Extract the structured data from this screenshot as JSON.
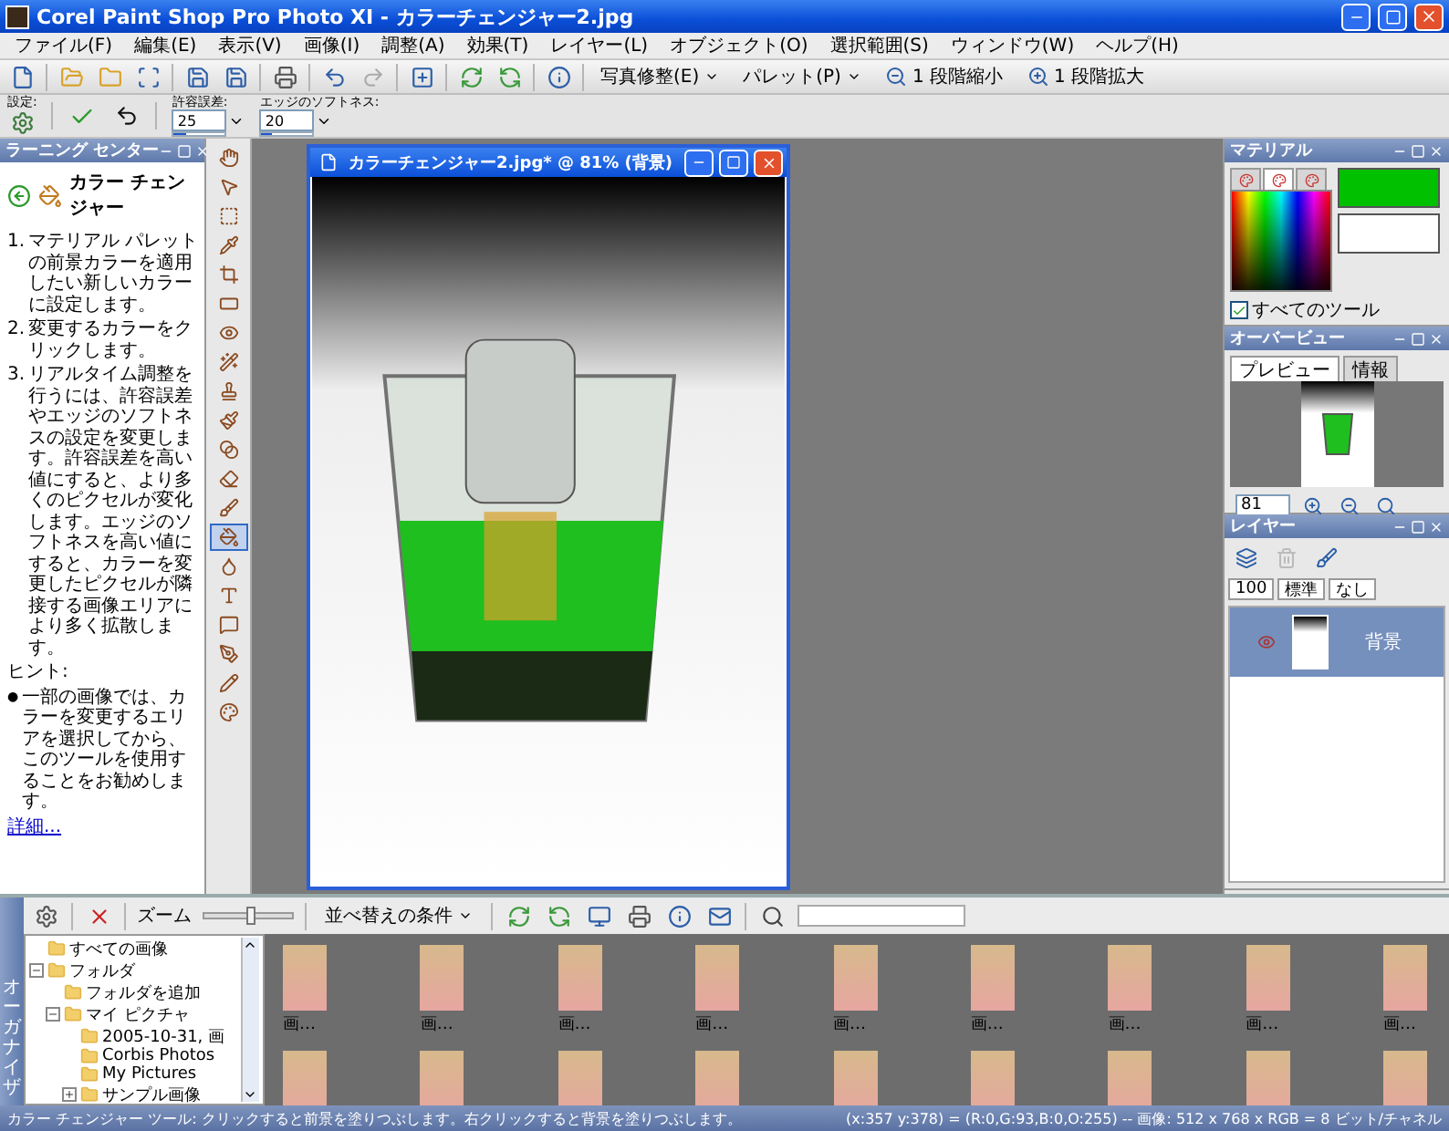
{
  "window": {
    "title": "Corel Paint Shop Pro Photo XI - カラーチェンジャー2.jpg"
  },
  "menu": [
    "ファイル(F)",
    "編集(E)",
    "表示(V)",
    "画像(I)",
    "調整(A)",
    "効果(T)",
    "レイヤー(L)",
    "オブジェクト(O)",
    "選択範囲(S)",
    "ウィンドウ(W)",
    "ヘルプ(H)"
  ],
  "toolbar": {
    "buttons": [
      {
        "label": "写真修整(E)",
        "kind": "dropdown"
      },
      {
        "label": "パレット(P)",
        "kind": "dropdown"
      },
      {
        "label": "1 段階縮小",
        "kind": "zoom-out"
      },
      {
        "label": "1 段階拡大",
        "kind": "zoom-in"
      }
    ]
  },
  "tool_options": {
    "preset_label": "設定:",
    "fields": [
      {
        "label": "許容誤差:",
        "value": "25",
        "level": 0.25
      },
      {
        "label": "エッジのソフトネス:",
        "value": "20",
        "level": 0.2
      }
    ]
  },
  "learning_center": {
    "title": "ラーニング センター",
    "heading": "カラー チェンジャー",
    "steps": [
      {
        "number": "1.",
        "text": "マテリアル パレットの前景カラーを適用したい新しいカラーに設定します。"
      },
      {
        "number": "2.",
        "text": "変更するカラーをクリックします。"
      },
      {
        "number": "3.",
        "text": "リアルタイム調整を行うには、許容誤差やエッジのソフトネスの設定を変更します。許容誤差を高い値にすると、より多くのピクセルが変化します。エッジのソフトネスを高い値にすると、カラーを変更したピクセルが隣接する画像エリアにより多く拡散します。"
      }
    ],
    "hint_label": "ヒント:",
    "hints": [
      {
        "bullet": "●",
        "text": "一部の画像では、カラーを変更するエリアを選択してから、このツールを使用することをお勧めします。"
      }
    ],
    "link": "詳細..."
  },
  "toolbox": [
    {
      "selected": false
    },
    {
      "selected": false
    },
    {
      "selected": false
    },
    {
      "selected": false
    },
    {
      "selected": false
    },
    {
      "selected": false
    },
    {
      "selected": false
    },
    {
      "selected": false
    },
    {
      "selected": false
    },
    {
      "selected": false
    },
    {
      "selected": false
    },
    {
      "selected": false
    },
    {
      "selected": false
    },
    {
      "selected": true
    },
    {
      "selected": false
    },
    {
      "selected": false
    },
    {
      "selected": false
    },
    {
      "selected": false
    },
    {
      "selected": false
    },
    {
      "selected": false
    }
  ],
  "document": {
    "title": "カラーチェンジャー2.jpg* @  81% (背景)"
  },
  "materials": {
    "title": "マテリアル",
    "tabs": [
      {
        "selected": false
      },
      {
        "selected": true
      },
      {
        "selected": false
      }
    ],
    "all_tools": {
      "label": "すべてのツール",
      "checked": true
    }
  },
  "overview": {
    "title": "オーバービュー",
    "tabs": [
      {
        "label": "プレビュー",
        "selected": true
      },
      {
        "label": "情報",
        "selected": false
      }
    ],
    "zoom": "81"
  },
  "layers": {
    "title": "レイヤー",
    "opacity": "100",
    "blend": "標準",
    "lock": "なし",
    "rows": [
      {
        "name": "背景",
        "selected": true
      }
    ]
  },
  "organizer": {
    "tab": "オーガナイザ",
    "zoom": {
      "label": "ズーム",
      "level": 0.55
    },
    "sort": "並べ替えの条件",
    "tree": [
      {
        "label": "すべての画像"
      },
      {
        "label": "フォルダ",
        "expanded": true,
        "children": [
          {
            "label": "フォルダを追加"
          },
          {
            "label": "マイ ピクチャ",
            "expanded": true,
            "children": [
              {
                "label": "2005-10-31, 画"
              },
              {
                "label": "Corbis Photos"
              },
              {
                "label": "My Pictures"
              },
              {
                "label": "サンプル画像",
                "expanded": false
              }
            ]
          }
        ]
      }
    ],
    "thumbnail_rows": [
      [
        {
          "caption": "画…"
        },
        {
          "caption": "画…"
        },
        {
          "caption": "画…"
        },
        {
          "caption": "画…"
        },
        {
          "caption": "画…"
        },
        {
          "caption": "画…"
        },
        {
          "caption": "画…"
        },
        {
          "caption": "画…"
        },
        {
          "caption": "画…"
        }
      ],
      [
        {
          "photo": true
        },
        {
          "photo": true
        },
        {
          "photo": true
        },
        {
          "photo": true
        },
        {
          "photo": true
        },
        {
          "photo": true
        },
        {
          "photo": true
        },
        {
          "photo": true
        },
        {
          "photo": true
        }
      ]
    ]
  },
  "status_bar": {
    "hint": "カラー チェンジャー ツール: クリックすると前景を塗りつぶします。右クリックすると背景を塗りつぶします。",
    "info": "(x:357 y:378) = (R:0,G:93,B:0,O:255) -- 画像: 512 x 768 x RGB = 8 ビット/チャネル"
  }
}
